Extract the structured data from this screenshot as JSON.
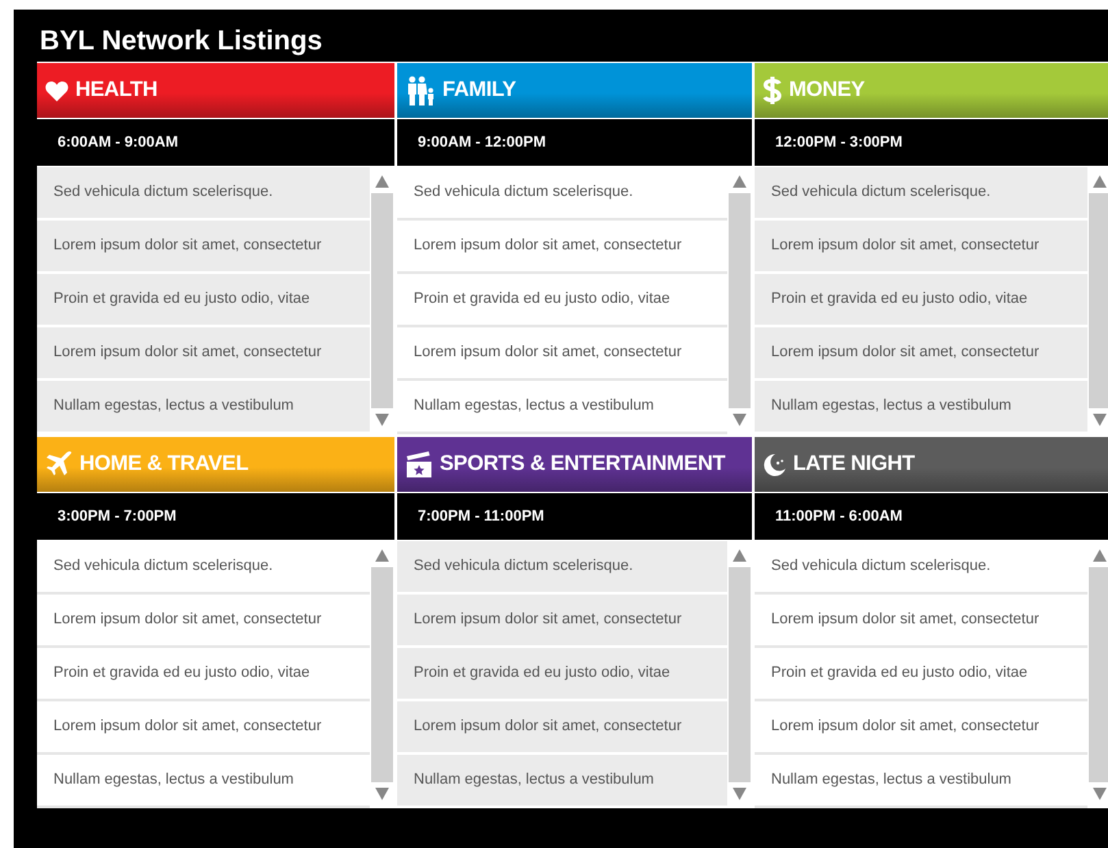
{
  "title": "BYL Network Listings",
  "sections": [
    {
      "title": "HEALTH",
      "color": "#ed1c24",
      "hours": "6:00AM - 9:00AM",
      "shaded": true,
      "items": [
        "Sed vehicula dictum scelerisque.",
        "Lorem ipsum dolor sit amet, consectetur",
        "Proin et gravida ed eu justo odio, vitae",
        "Lorem ipsum dolor sit amet, consectetur",
        "Nullam egestas, lectus a vestibulum"
      ]
    },
    {
      "title": "FAMILY",
      "color": "#0093d8",
      "hours": "9:00AM - 12:00PM",
      "shaded": false,
      "items": [
        "Sed vehicula dictum scelerisque.",
        "Lorem ipsum dolor sit amet, consectetur",
        "Proin et gravida ed eu justo odio, vitae",
        "Lorem ipsum dolor sit amet, consectetur",
        "Nullam egestas, lectus a vestibulum"
      ]
    },
    {
      "title": "MONEY",
      "color": "#a4c93a",
      "hours": "12:00PM - 3:00PM",
      "shaded": true,
      "items": [
        "Sed vehicula dictum scelerisque.",
        "Lorem ipsum dolor sit amet, consectetur",
        "Proin et gravida ed eu justo odio, vitae",
        "Lorem ipsum dolor sit amet, consectetur",
        "Nullam egestas, lectus a vestibulum"
      ]
    },
    {
      "title": "HOME & TRAVEL",
      "color": "#fbb116",
      "hours": "3:00PM - 7:00PM",
      "shaded": false,
      "items": [
        "Sed vehicula dictum scelerisque.",
        "Lorem ipsum dolor sit amet, consectetur",
        "Proin et gravida ed eu justo odio, vitae",
        "Lorem ipsum dolor sit amet, consectetur",
        "Nullam egestas, lectus a vestibulum"
      ]
    },
    {
      "title": "SPORTS & ENTERTAINMENT",
      "color": "#5f3293",
      "hours": "7:00PM - 11:00PM",
      "shaded": true,
      "items": [
        "Sed vehicula dictum scelerisque.",
        "Lorem ipsum dolor sit amet, consectetur",
        "Proin et gravida ed eu justo odio, vitae",
        "Lorem ipsum dolor sit amet, consectetur",
        "Nullam egestas, lectus a vestibulum"
      ]
    },
    {
      "title": "LATE NIGHT",
      "color": "#5c5c5c",
      "hours": "11:00PM - 6:00AM",
      "shaded": false,
      "items": [
        "Sed vehicula dictum scelerisque.",
        "Lorem ipsum dolor sit amet, consectetur",
        "Proin et gravida ed eu justo odio, vitae",
        "Lorem ipsum dolor sit amet, consectetur",
        "Nullam egestas, lectus a vestibulum"
      ]
    }
  ]
}
